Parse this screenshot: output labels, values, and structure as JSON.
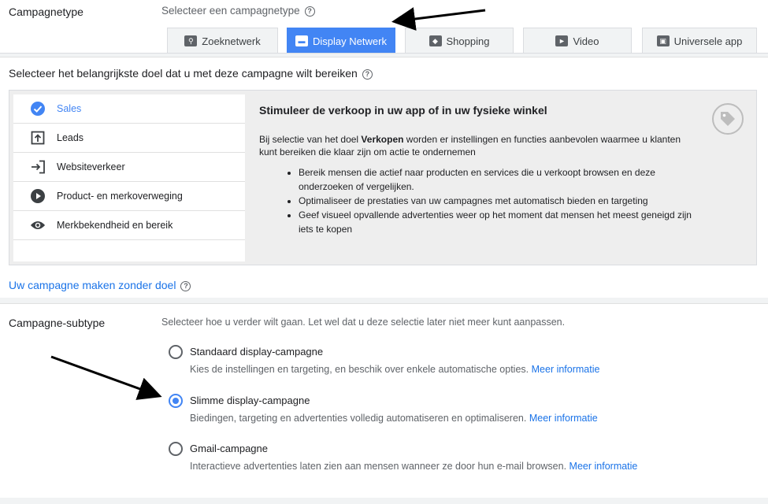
{
  "campaign_type": {
    "label": "Campagnetype",
    "prompt": "Selecteer een campagnetype",
    "tabs": [
      {
        "label": "Zoeknetwerk",
        "icon": "search-icon",
        "active": false
      },
      {
        "label": "Display Netwerk",
        "icon": "display-icon",
        "active": true
      },
      {
        "label": "Shopping",
        "icon": "tag-icon",
        "active": false
      },
      {
        "label": "Video",
        "icon": "video-icon",
        "active": false
      },
      {
        "label": "Universele app",
        "icon": "app-icon",
        "active": false
      }
    ]
  },
  "goal": {
    "heading": "Selecteer het belangrijkste doel dat u met deze campagne wilt bereiken",
    "items": [
      {
        "label": "Sales",
        "icon": "check-circle-icon",
        "selected": true
      },
      {
        "label": "Leads",
        "icon": "upload-box-icon",
        "selected": false
      },
      {
        "label": "Websiteverkeer",
        "icon": "login-icon",
        "selected": false
      },
      {
        "label": "Product- en merkoverweging",
        "icon": "play-circle-icon",
        "selected": false
      },
      {
        "label": "Merkbekendheid en bereik",
        "icon": "eye-icon",
        "selected": false
      }
    ],
    "detail": {
      "title": "Stimuleer de verkoop in uw app of in uw fysieke winkel",
      "body_pre": "Bij selectie van het doel ",
      "body_bold": "Verkopen",
      "body_post": " worden er instellingen en functies aanbevolen waarmee u klanten kunt bereiken die klaar zijn om actie te ondernemen",
      "bullets": [
        "Bereik mensen die actief naar producten en services die u verkoopt browsen en deze onderzoeken of vergelijken.",
        "Optimaliseer de prestaties van uw campagnes met automatisch bieden en targeting",
        "Geef visueel opvallende advertenties weer op het moment dat mensen het meest geneigd zijn iets te kopen"
      ]
    },
    "no_goal_link": "Uw campagne maken zonder doel"
  },
  "subtype": {
    "label": "Campagne-subtype",
    "prompt": "Selecteer hoe u verder wilt gaan. Let wel dat u deze selectie later niet meer kunt aanpassen.",
    "more_info": "Meer informatie",
    "options": [
      {
        "title": "Standaard display-campagne",
        "desc": "Kies de instellingen en targeting, en beschik over enkele automatische opties.",
        "selected": false
      },
      {
        "title": "Slimme display-campagne",
        "desc": "Biedingen, targeting en advertenties volledig automatiseren en optimaliseren.",
        "selected": true
      },
      {
        "title": "Gmail-campagne",
        "desc": "Interactieve advertenties laten zien aan mensen wanneer ze door hun e-mail browsen.",
        "selected": false
      }
    ]
  },
  "colors": {
    "accent": "#4285f4",
    "link": "#1a73e8"
  }
}
